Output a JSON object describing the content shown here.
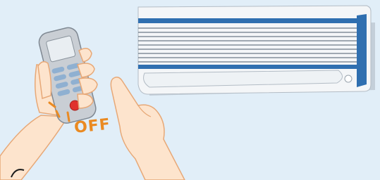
{
  "scene": {
    "remote_status_text": "OFF",
    "colors": {
      "background": "#e1eef8",
      "skin": "#fde4cd",
      "skin_outline": "#e7a877",
      "ac_blue": "#2f6fb0",
      "remote_body": "#c9ced4",
      "button_blue": "#8fb0d1",
      "button_red": "#e0322c",
      "accent_orange": "#ea8a22"
    },
    "icons": [
      "air-conditioner-icon",
      "remote-control-icon",
      "hand-icon",
      "pointing-finger-icon"
    ]
  }
}
